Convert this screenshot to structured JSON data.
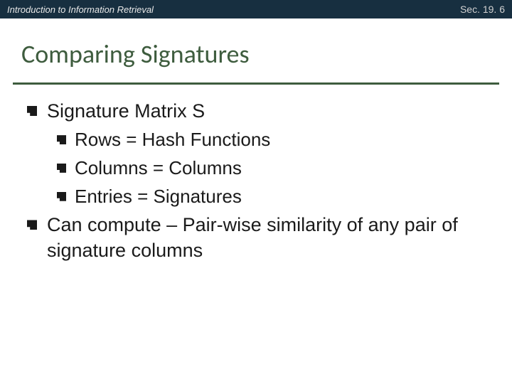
{
  "header": {
    "course": "Introduction to Information Retrieval",
    "section": "Sec. 19. 6"
  },
  "title": "Comparing Signatures",
  "bullets": [
    {
      "level": 1,
      "text": "Signature Matrix S"
    },
    {
      "level": 2,
      "text": "Rows = Hash Functions"
    },
    {
      "level": 2,
      "text": "Columns = Columns"
    },
    {
      "level": 2,
      "text": "Entries = Signatures"
    },
    {
      "level": 1,
      "text": "Can compute – Pair-wise similarity of any pair of  signature columns"
    }
  ]
}
